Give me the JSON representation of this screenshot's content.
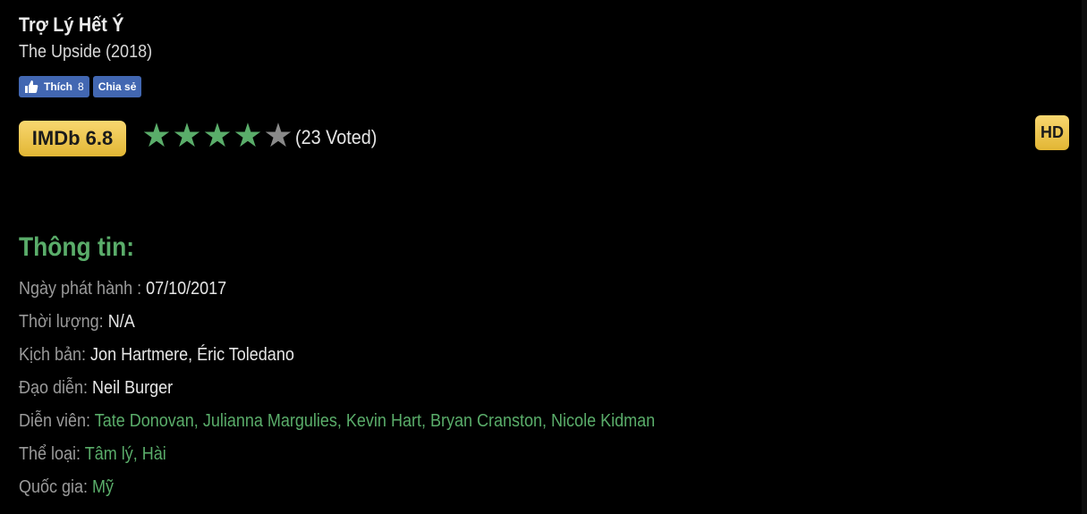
{
  "movie": {
    "title": "Trợ Lý Hết Ý",
    "original_title": "The Upside (2018)"
  },
  "facebook": {
    "like_label": "Thích",
    "like_count": "8",
    "share_label": "Chia sẻ"
  },
  "rating": {
    "imdb_label": "IMDb 6.8",
    "stars_filled": 4,
    "stars_total": 5,
    "voted_text": "(23 Voted)",
    "quality_badge": "HD"
  },
  "info": {
    "section_title": "Thông tin:",
    "release_label": "Ngày phát hành : ",
    "release_value": "07/10/2017",
    "duration_label": "Thời lượng: ",
    "duration_value": "N/A",
    "writers_label": "Kịch bản: ",
    "writers_value": "Jon Hartmere, Éric Toledano",
    "director_label": "Đạo diễn: ",
    "director_value": "Neil Burger",
    "cast_label": "Diễn viên: ",
    "cast": [
      "Tate Donovan",
      "Julianna Margulies",
      "Kevin Hart",
      "Bryan Cranston",
      "Nicole Kidman"
    ],
    "genre_label": "Thể loại: ",
    "genres": [
      "Tâm lý",
      "Hài"
    ],
    "country_label": "Quốc gia: ",
    "country": "Mỹ"
  },
  "colors": {
    "background": "#000000",
    "accent_green": "#5aad6a",
    "badge_gold": "#e9c04a",
    "facebook_blue": "#4267b2"
  }
}
